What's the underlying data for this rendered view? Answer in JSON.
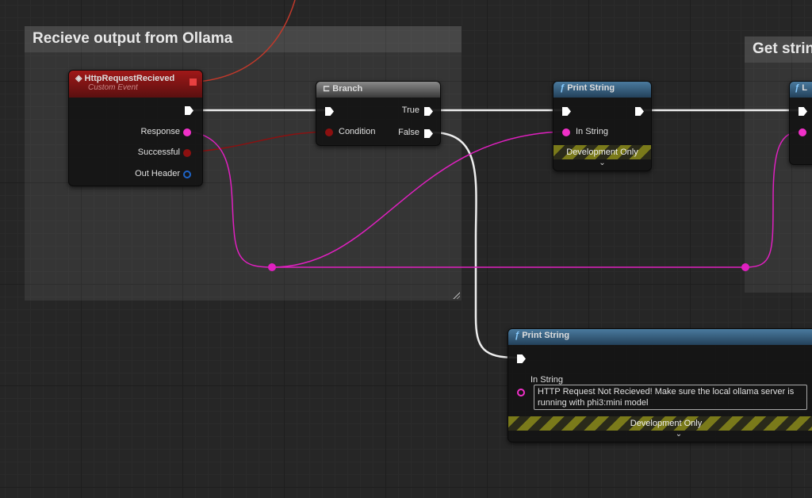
{
  "comments": [
    {
      "title": "Recieve output from Ollama"
    },
    {
      "title": "Get strin"
    }
  ],
  "event_node": {
    "title": "HttpRequestRecieved",
    "subtitle": "Custom Event",
    "pins": {
      "response": "Response",
      "successful": "Successful",
      "out_header": "Out Header"
    }
  },
  "branch_node": {
    "title": "Branch",
    "condition": "Condition",
    "true": "True",
    "false": "False"
  },
  "print_string_1": {
    "title": "Print String",
    "in_string": "In String",
    "dev_only": "Development Only"
  },
  "print_string_2": {
    "title": "Print String",
    "in_string": "In String",
    "value": "HTTP Request Not Recieved! Make sure the local ollama server is running with phi3:mini model",
    "dev_only": "Development Only"
  },
  "partial_node": {
    "title": "L"
  },
  "colors": {
    "exec": "#ffffff",
    "string": "#f030c8",
    "bool": "#8c1010",
    "struct": "#1e64c8",
    "event_header": "#a01818",
    "function_header": "#4a7a9e"
  }
}
